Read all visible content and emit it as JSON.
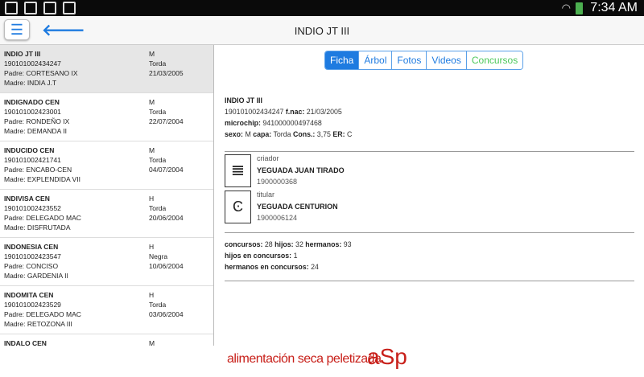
{
  "status": {
    "time": "7:34 AM"
  },
  "header": {
    "title": "INDIO JT III"
  },
  "list": [
    {
      "name": "INDIO JT III",
      "id": "190101002434247",
      "padre": "Padre: CORTESANO IX",
      "madre": "Madre: INDIA J.T",
      "sexo": "M",
      "capa": "Torda",
      "fecha": "21/03/2005"
    },
    {
      "name": "INDIGNADO CEN",
      "id": "190101002423001",
      "padre": "Padre: RONDEÑO IX",
      "madre": "Madre: DEMANDA II",
      "sexo": "M",
      "capa": "Torda",
      "fecha": "22/07/2004"
    },
    {
      "name": "INDUCIDO CEN",
      "id": "190101002421741",
      "padre": "Padre: ENCABO-CEN",
      "madre": "Madre: EXPLENDIDA VII",
      "sexo": "M",
      "capa": "Torda",
      "fecha": "04/07/2004"
    },
    {
      "name": "INDIVISA CEN",
      "id": "190101002423552",
      "padre": "Padre: DELEGADO MAC",
      "madre": "Madre: DISFRUTADA",
      "sexo": "H",
      "capa": "Torda",
      "fecha": "20/06/2004"
    },
    {
      "name": "INDONESIA CEN",
      "id": "190101002423547",
      "padre": "Padre: CONCISO",
      "madre": "Madre: GARDENIA II",
      "sexo": "H",
      "capa": "Negra",
      "fecha": "10/06/2004"
    },
    {
      "name": "INDOMITA CEN",
      "id": "190101002423529",
      "padre": "Padre: DELEGADO MAC",
      "madre": "Madre: RETOZONA III",
      "sexo": "H",
      "capa": "Torda",
      "fecha": "03/06/2004"
    },
    {
      "name": "INDALO CEN",
      "id": "",
      "padre": "",
      "madre": "",
      "sexo": "M",
      "capa": "",
      "fecha": ""
    }
  ],
  "tabs": [
    "Ficha",
    "Árbol",
    "Fotos",
    "Videos",
    "Concursos"
  ],
  "detail": {
    "name": "INDIO JT III",
    "id": "190101002434247",
    "fnac_label": "f.nac:",
    "fnac": "21/03/2005",
    "microchip_label": "microchip:",
    "microchip": "941000000497468",
    "sexo_label": "sexo:",
    "sexo": "M",
    "capa_label": "capa:",
    "capa": "Torda",
    "cons_label": "Cons.:",
    "cons": "3,75",
    "er_label": "ER:",
    "er": "C",
    "criador": {
      "role": "criador",
      "name": "YEGUADA JUAN TIRADO",
      "code": "1900000368"
    },
    "titular": {
      "role": "titular",
      "name": "YEGUADA CENTURION",
      "code": "1900006124"
    },
    "concursos_label": "concursos:",
    "concursos": "28",
    "hijos_label": "hijos:",
    "hijos": "32",
    "hermanos_label": "hermanos:",
    "hermanos": "93",
    "hijos_conc_label": "hijos en concursos:",
    "hijos_conc": "1",
    "herm_conc_label": "hermanos en concursos:",
    "herm_conc": "24"
  },
  "banner": {
    "text": "alimentación seca peletizada",
    "brand": "aSp"
  }
}
